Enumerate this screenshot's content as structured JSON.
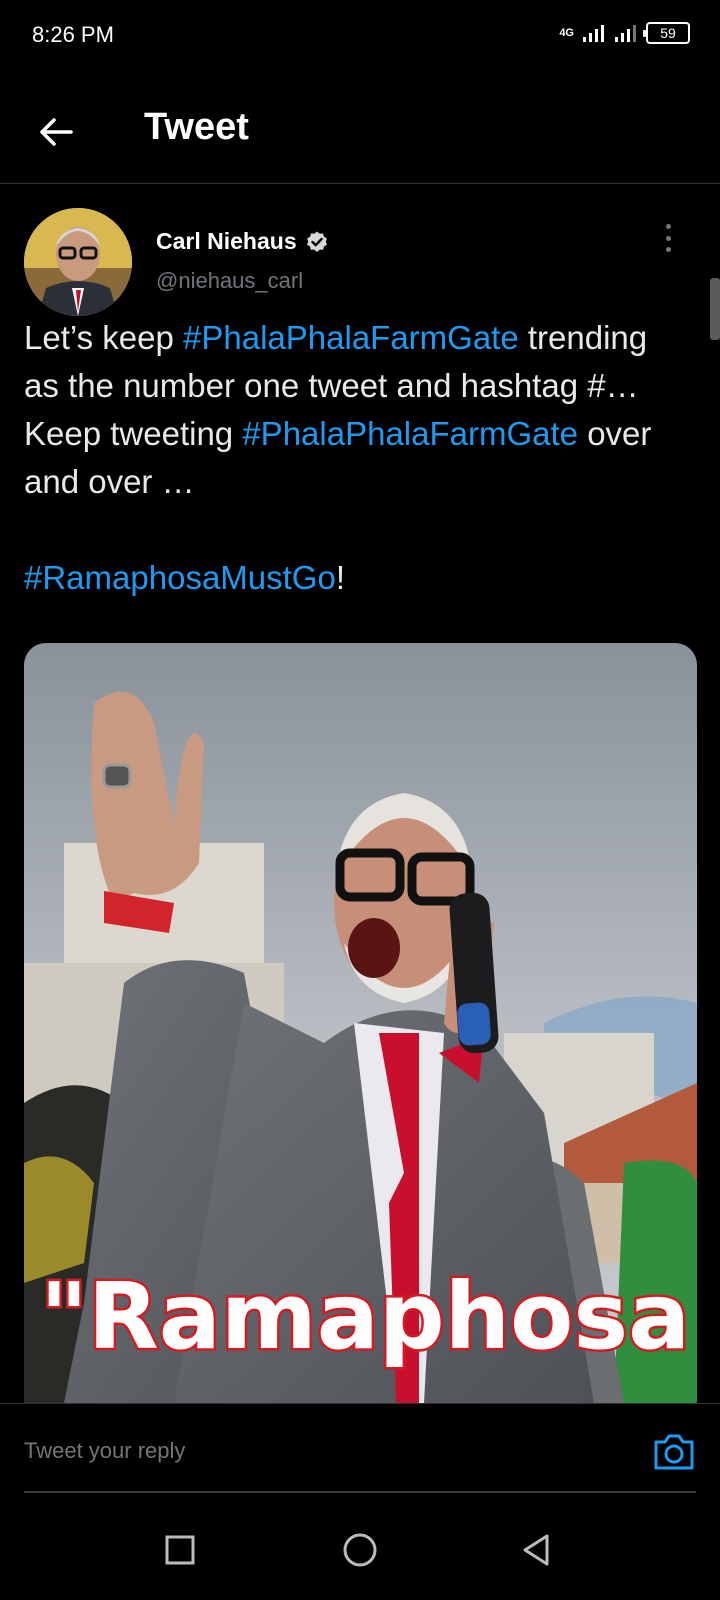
{
  "status": {
    "time": "8:26 PM",
    "network": "4G",
    "battery": "59"
  },
  "header": {
    "title": "Tweet"
  },
  "tweet": {
    "author_name": "Carl Niehaus",
    "author_handle": "@niehaus_carl",
    "text": {
      "p1": "Let’s keep ",
      "tag1": "#PhalaPhalaFarmGate",
      "p2": " trending as the number one tweet and hashtag #… Keep tweeting ",
      "tag2": "#PhalaPhalaFarmGate",
      "p3": " over and over …",
      "tag3": "#RamaphosaMustGo",
      "p4": "!"
    },
    "media_caption": "\"Ramaphosa"
  },
  "reply": {
    "placeholder": "Tweet your reply"
  },
  "icons": {
    "back": "back-arrow-icon",
    "verified": "verified-badge-icon",
    "more": "more-vertical-icon",
    "camera": "camera-icon",
    "recents": "square-icon",
    "home": "circle-icon",
    "back_nav": "triangle-back-icon"
  },
  "colors": {
    "link": "#1d9bf0",
    "background": "#000000",
    "secondary_text": "#71767b"
  }
}
